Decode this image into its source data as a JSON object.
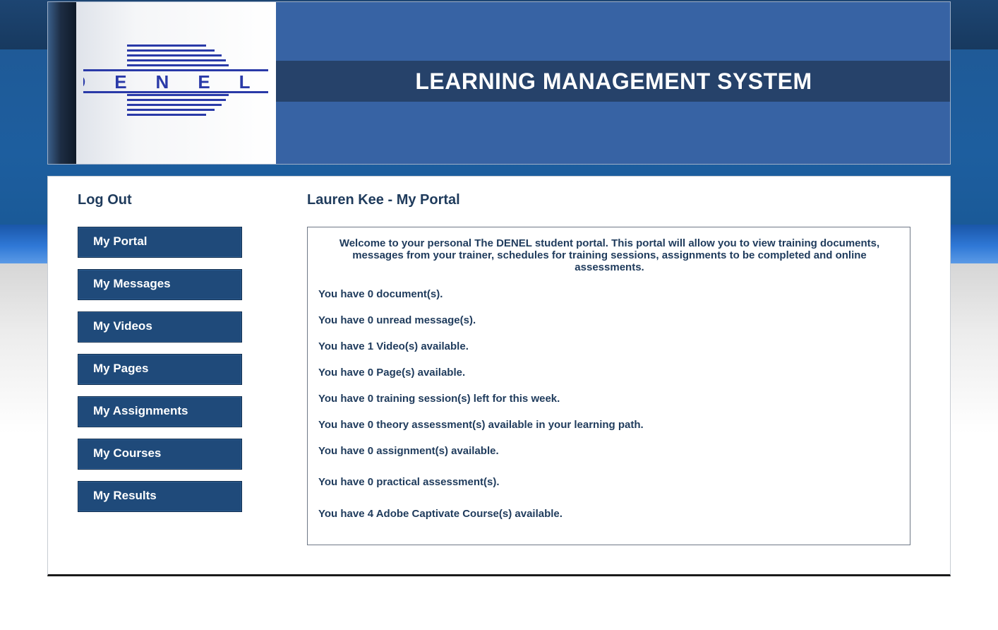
{
  "header": {
    "logo_text": "DENEL",
    "title": "LEARNING MANAGEMENT SYSTEM"
  },
  "sidebar": {
    "logout_label": "Log Out",
    "items": [
      {
        "label": "My Portal"
      },
      {
        "label": "My Messages"
      },
      {
        "label": "My Videos"
      },
      {
        "label": "My Pages"
      },
      {
        "label": "My Assignments"
      },
      {
        "label": "My Courses"
      },
      {
        "label": "My Results"
      }
    ]
  },
  "main": {
    "heading": "Lauren Kee - My Portal",
    "welcome": "Welcome to your personal The DENEL student portal. This portal will allow you to view training documents, messages from your trainer, schedules for training sessions, assignments to be completed and online assessments.",
    "stats": [
      "You have 0 document(s).",
      "You have 0 unread message(s).",
      "You have 1 Video(s) available.",
      "You have 0 Page(s) available.",
      "You have 0 training session(s) left for this week.",
      "You have 0 theory assessment(s) available in your learning path.",
      "You have 0 assignment(s) available.",
      "You have 0 practical assessment(s).",
      "You have 4 Adobe Captivate Course(s) available."
    ]
  },
  "colors": {
    "header_blue": "#3763a4",
    "title_band": "#26426a",
    "nav_button": "#1f4a7a",
    "text_dark_blue": "#1f3b5c",
    "logo_blue": "#2a3aa8"
  }
}
